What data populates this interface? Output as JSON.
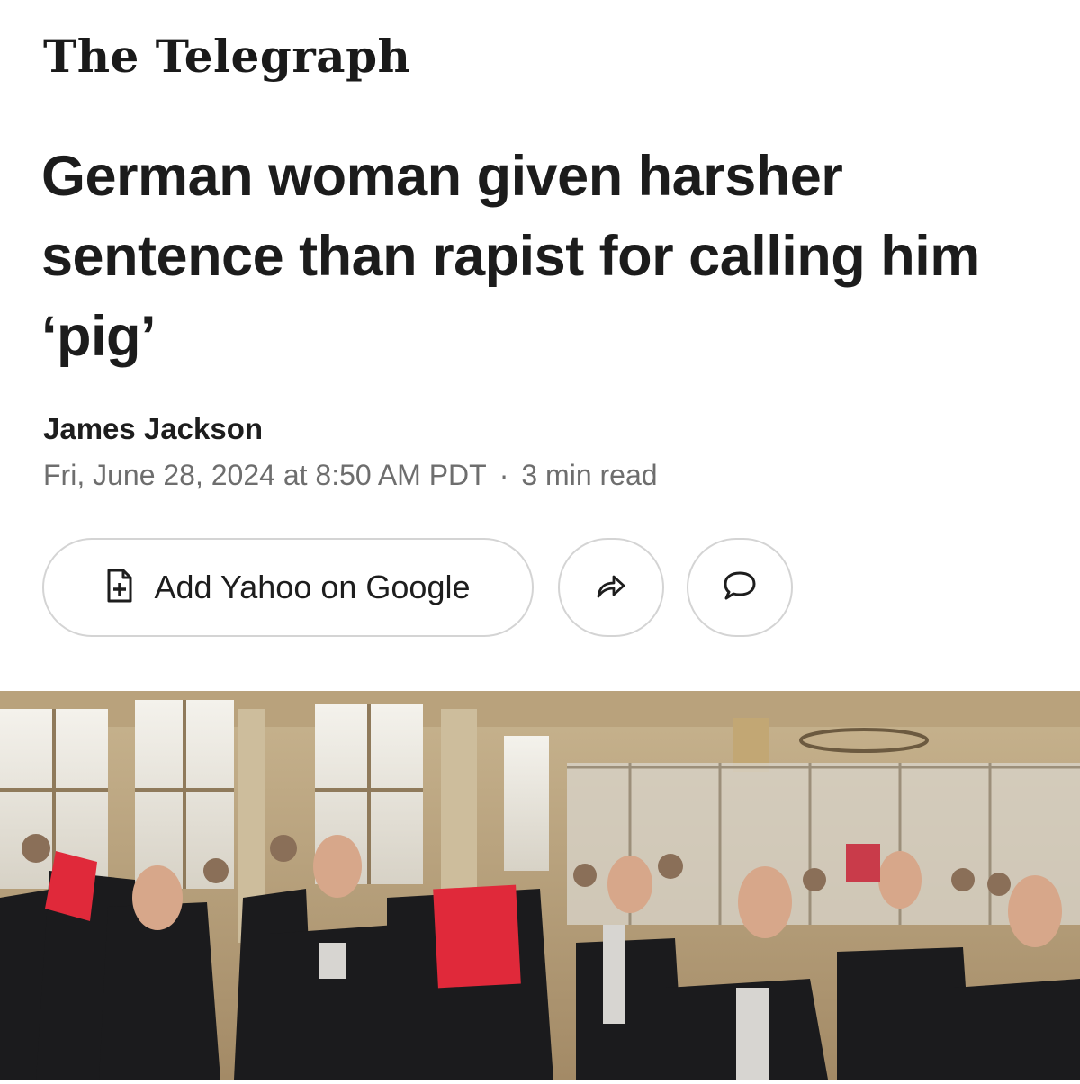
{
  "masthead": {
    "name": "The Telegraph"
  },
  "article": {
    "headline": "German woman given harsher sentence than rapist for calling him ‘pig’",
    "author": "James Jackson",
    "date": "Fri, June 28, 2024 at 8:50 AM PDT",
    "separator": "·",
    "read_time": "3 min read"
  },
  "actions": {
    "add_label": "Add Yahoo on Google",
    "add_icon": "doc-plus-icon",
    "share_icon": "share-icon",
    "comment_icon": "comment-icon"
  },
  "photo": {
    "subject": "courtroom-photo"
  }
}
